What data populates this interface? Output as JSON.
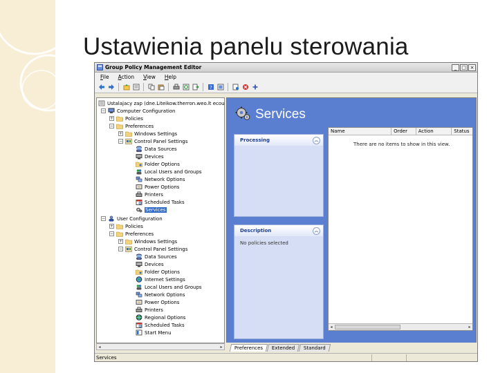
{
  "slide": {
    "title": "Ustawienia panelu sterowania"
  },
  "window": {
    "title": "Group Policy Management Editor",
    "controls": {
      "minimize": "_",
      "maximize": "□",
      "close": "×"
    }
  },
  "menu": [
    "File",
    "Action",
    "View",
    "Help"
  ],
  "toolbar_icons": [
    "back-arrow-icon",
    "forward-arrow-icon",
    "up-folder-icon",
    "properties-icon",
    "copy-icon",
    "paste-icon",
    "print-icon",
    "refresh-icon",
    "export-icon",
    "help-icon",
    "help-topics-icon",
    "new-item-icon",
    "delete-icon",
    "add-icon"
  ],
  "tree": {
    "root": "Ustalajacy zap (dne.Liteikow.therron.weo.lt ecoup)",
    "computer_configuration": {
      "label": "Computer Configuration",
      "policies": "Policies",
      "preferences": "Preferences",
      "windows_settings": "Windows Settings",
      "control_panel_settings": "Control Panel Settings",
      "items": [
        "Data Sources",
        "Devices",
        "Folder Options",
        "Local Users and Groups",
        "Network Options",
        "Power Options",
        "Printers",
        "Scheduled Tasks",
        "Services"
      ]
    },
    "user_configuration": {
      "label": "User Configuration",
      "policies": "Policies",
      "preferences": "Preferences",
      "windows_settings": "Windows Settings",
      "control_panel_settings": "Control Panel Settings",
      "items": [
        "Data Sources",
        "Devices",
        "Folder Options",
        "Internet Settings",
        "Local Users and Groups",
        "Network Options",
        "Power Options",
        "Printers",
        "Regional Options",
        "Scheduled Tasks",
        "Start Menu"
      ]
    },
    "selected": "Services"
  },
  "main": {
    "heading": "Services",
    "processing_panel": {
      "title": "Processing"
    },
    "description_panel": {
      "title": "Description",
      "text": "No policies selected"
    },
    "columns": [
      "Name",
      "Order",
      "Action",
      "Status"
    ],
    "empty_message": "There are no items to show in this view."
  },
  "tabs": [
    "Preferences",
    "Extended",
    "Standard"
  ],
  "active_tab": "Preferences",
  "status": {
    "text": "Services"
  }
}
